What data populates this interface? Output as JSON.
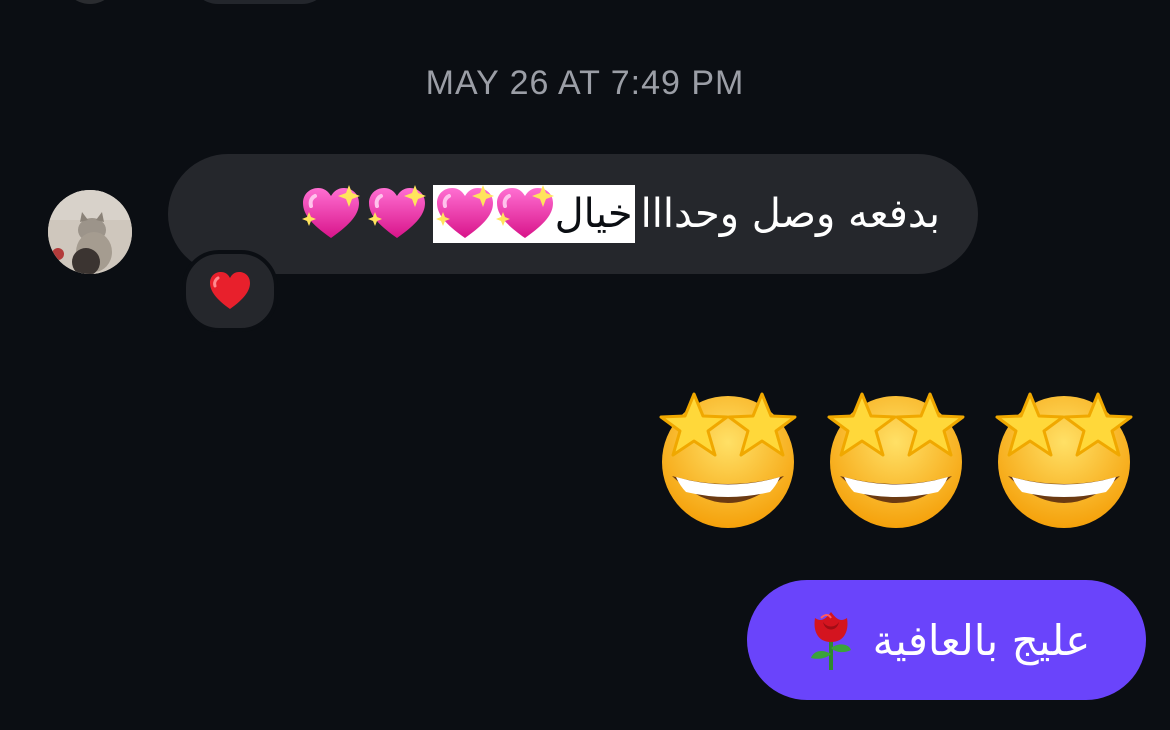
{
  "conversation": {
    "timestamp": "MAY 26 AT 7:49 PM",
    "incoming_message": {
      "text_part": "بدفعه وصل وحدااا",
      "highlighted_word": "خيال",
      "emojis": [
        "sparkling-heart",
        "sparkling-heart",
        "sparkling-heart",
        "sparkling-heart"
      ],
      "reaction": "red-heart"
    },
    "emoji_message": {
      "emojis": [
        "star-struck",
        "star-struck",
        "star-struck"
      ]
    },
    "outgoing_message": {
      "text": "عليج بالعافية",
      "emoji": "rose"
    }
  },
  "colors": {
    "background": "#0b0e13",
    "incoming_bubble": "#25272c",
    "outgoing_bubble": "#6a44fb",
    "timestamp": "#9b9ea6"
  }
}
